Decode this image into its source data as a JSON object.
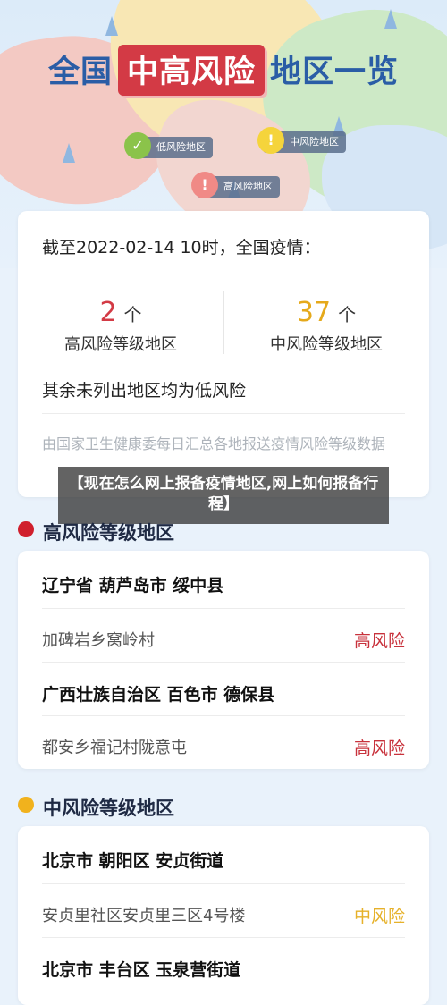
{
  "header": {
    "title_prefix": "全国",
    "title_highlight": "中高风险",
    "title_suffix": "地区一览",
    "legend": [
      {
        "label": "低风险地区",
        "symbol": "✓",
        "color": "#8bc34a"
      },
      {
        "label": "中风险地区",
        "symbol": "!",
        "color": "#f5d43b"
      },
      {
        "label": "高风险地区",
        "symbol": "!",
        "color": "#f08a86"
      }
    ]
  },
  "summary": {
    "as_of": "截至2022-02-14 10时，全国疫情：",
    "high": {
      "count": "2",
      "unit": "个",
      "label": "高风险等级地区",
      "color": "#d33a45"
    },
    "medium": {
      "count": "37",
      "unit": "个",
      "label": "中风险等级地区",
      "color": "#e5a91b"
    },
    "rest_note": "其余未列出地区均为低风险",
    "source": "由国家卫生健康委每日汇总各地报送疫情风险等级数据"
  },
  "overlay": {
    "caption": "【现在怎么网上报备疫情地区,网上如何报备行程】"
  },
  "high_section": {
    "title": "高风险等级地区",
    "dot_color": "#d01f2d",
    "items": [
      {
        "area": "辽宁省 葫芦岛市 绥中县",
        "place": "加碑岩乡窝岭村",
        "risk": "高风险"
      },
      {
        "area": "广西壮族自治区 百色市 德保县",
        "place": "都安乡福记村陇意屯",
        "risk": "高风险"
      }
    ],
    "risk_color": "#c8323c"
  },
  "medium_section": {
    "title": "中风险等级地区",
    "dot_color": "#f1b21d",
    "items": [
      {
        "area": "北京市 朝阳区 安贞街道",
        "place": "安贞里社区安贞里三区4号楼",
        "risk": "中风险"
      },
      {
        "area": "北京市 丰台区 玉泉营街道"
      }
    ],
    "risk_color": "#e6b12a"
  }
}
